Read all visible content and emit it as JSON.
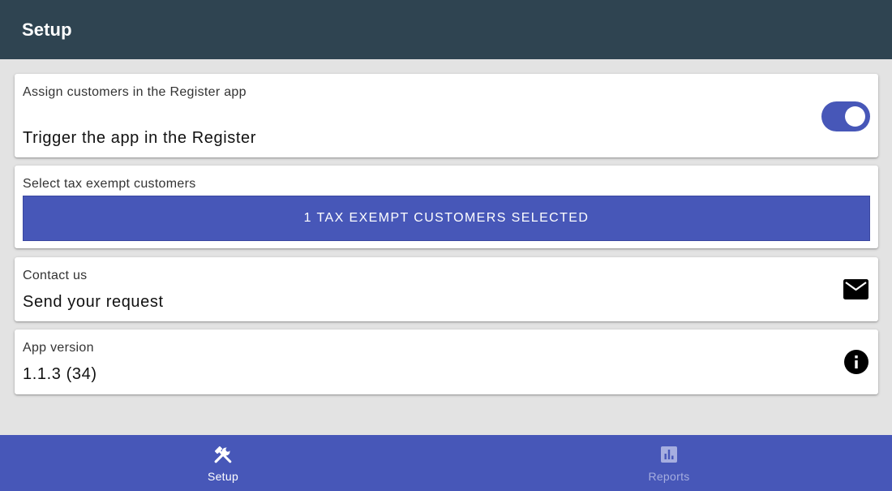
{
  "header": {
    "title": "Setup"
  },
  "cards": {
    "register": {
      "label": "Assign customers in the Register app",
      "value": "Trigger the app in the Register",
      "toggle_on": true
    },
    "tax": {
      "label": "Select tax exempt customers",
      "button_label": "1 TAX EXEMPT CUSTOMERS SELECTED"
    },
    "contact": {
      "label": "Contact us",
      "value": "Send your request",
      "icon": "mail-icon"
    },
    "version": {
      "label": "App version",
      "value": "1.1.3 (34)",
      "icon": "info-icon"
    }
  },
  "bottom_nav": {
    "items": [
      {
        "label": "Setup",
        "icon": "tools-icon",
        "active": true
      },
      {
        "label": "Reports",
        "icon": "bar-chart-icon",
        "active": false
      }
    ]
  },
  "colors": {
    "header_bg": "#2f4451",
    "accent": "#4757b8",
    "page_bg": "#e3e3e3",
    "nav_inactive": "#a6aee0"
  }
}
